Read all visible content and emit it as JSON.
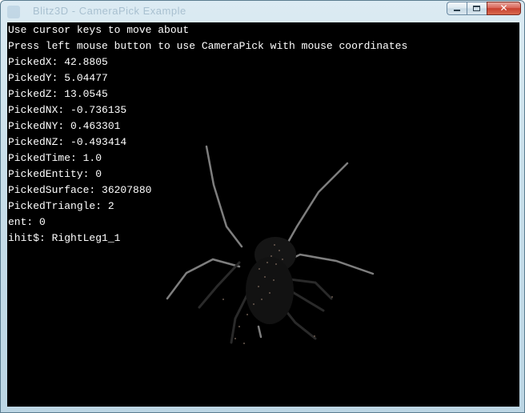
{
  "window": {
    "title": "Blitz3D - CameraPick Example",
    "buttons": {
      "minimize": "minimize",
      "maximize": "maximize",
      "close": "✕"
    }
  },
  "console_lines": [
    "Use cursor keys to move about",
    "Press left mouse button to use CameraPick with mouse coordinates",
    "PickedX: 42.8805",
    "PickedY: 5.04477",
    "PickedZ: 13.0545",
    "PickedNX: -0.736135",
    "PickedNY: 0.463301",
    "PickedNZ: -0.493414",
    "PickedTime: 1.0",
    "PickedEntity: 0",
    "PickedSurface: 36207880",
    "PickedTriangle: 2",
    "ent: 0",
    "ihit$: RightLeg1_1"
  ],
  "colors": {
    "background": "#000000",
    "text": "#ffffff",
    "legs": "#8a8a8a",
    "body": "#1c1c1c"
  },
  "icons": {
    "window_icon": "app-icon",
    "minimize": "minimize-icon",
    "maximize": "maximize-icon",
    "close": "close-icon"
  }
}
